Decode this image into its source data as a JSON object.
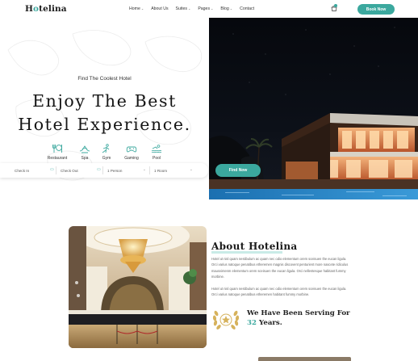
{
  "brand": {
    "name_prefix": "H",
    "name_o": "o",
    "name_suffix": "telina",
    "accent": "#3ba89e"
  },
  "nav": {
    "items": [
      {
        "label": "Home",
        "has_dropdown": true
      },
      {
        "label": "About Us",
        "has_dropdown": false
      },
      {
        "label": "Suites",
        "has_dropdown": true
      },
      {
        "label": "Pages",
        "has_dropdown": true
      },
      {
        "label": "Blog",
        "has_dropdown": true
      },
      {
        "label": "Contact",
        "has_dropdown": false
      }
    ],
    "caret": "⌄",
    "cart_icon": "shopping-bag-icon",
    "book_now": "Book Now"
  },
  "hero": {
    "tagline": "Find The Coolest Hotel",
    "title_line1": "Enjoy The Best",
    "title_line2": "Hotel Experience.",
    "amenities": [
      {
        "label": "Restaurant",
        "icon": "restaurant-icon"
      },
      {
        "label": "Spa",
        "icon": "spa-icon"
      },
      {
        "label": "Gym",
        "icon": "gym-icon"
      },
      {
        "label": "Gaming",
        "icon": "gaming-icon"
      },
      {
        "label": "Pool",
        "icon": "pool-icon"
      }
    ],
    "booking": {
      "check_in": "Check In",
      "check_out": "Check Out",
      "persons": "1 Person",
      "rooms": "1 Room",
      "find_now": "Find Now"
    }
  },
  "about": {
    "title": "About Hotelina",
    "para1": "Hotel ut nisl quam nestibulum ac quam nec odio elementum orem sceisuen the eucan ligula. Orci varius natoque penatibus etheremen magnis discovent penturient more nascete ridiculus mausvimenm elementum orem sceisuen the eucan ligula. Orci nellentesque habitant fummy morbine.",
    "para2": "Hotel ut nisl quam nestibulum ac quam nec odio elementum orem sceisuen the eucan ligula. Orci varius natoque penatibus etheremen habitant fummy morbine.",
    "serving_line1": "We Have Been Serving For",
    "serving_years_num": "32",
    "serving_years_word": " Years."
  }
}
